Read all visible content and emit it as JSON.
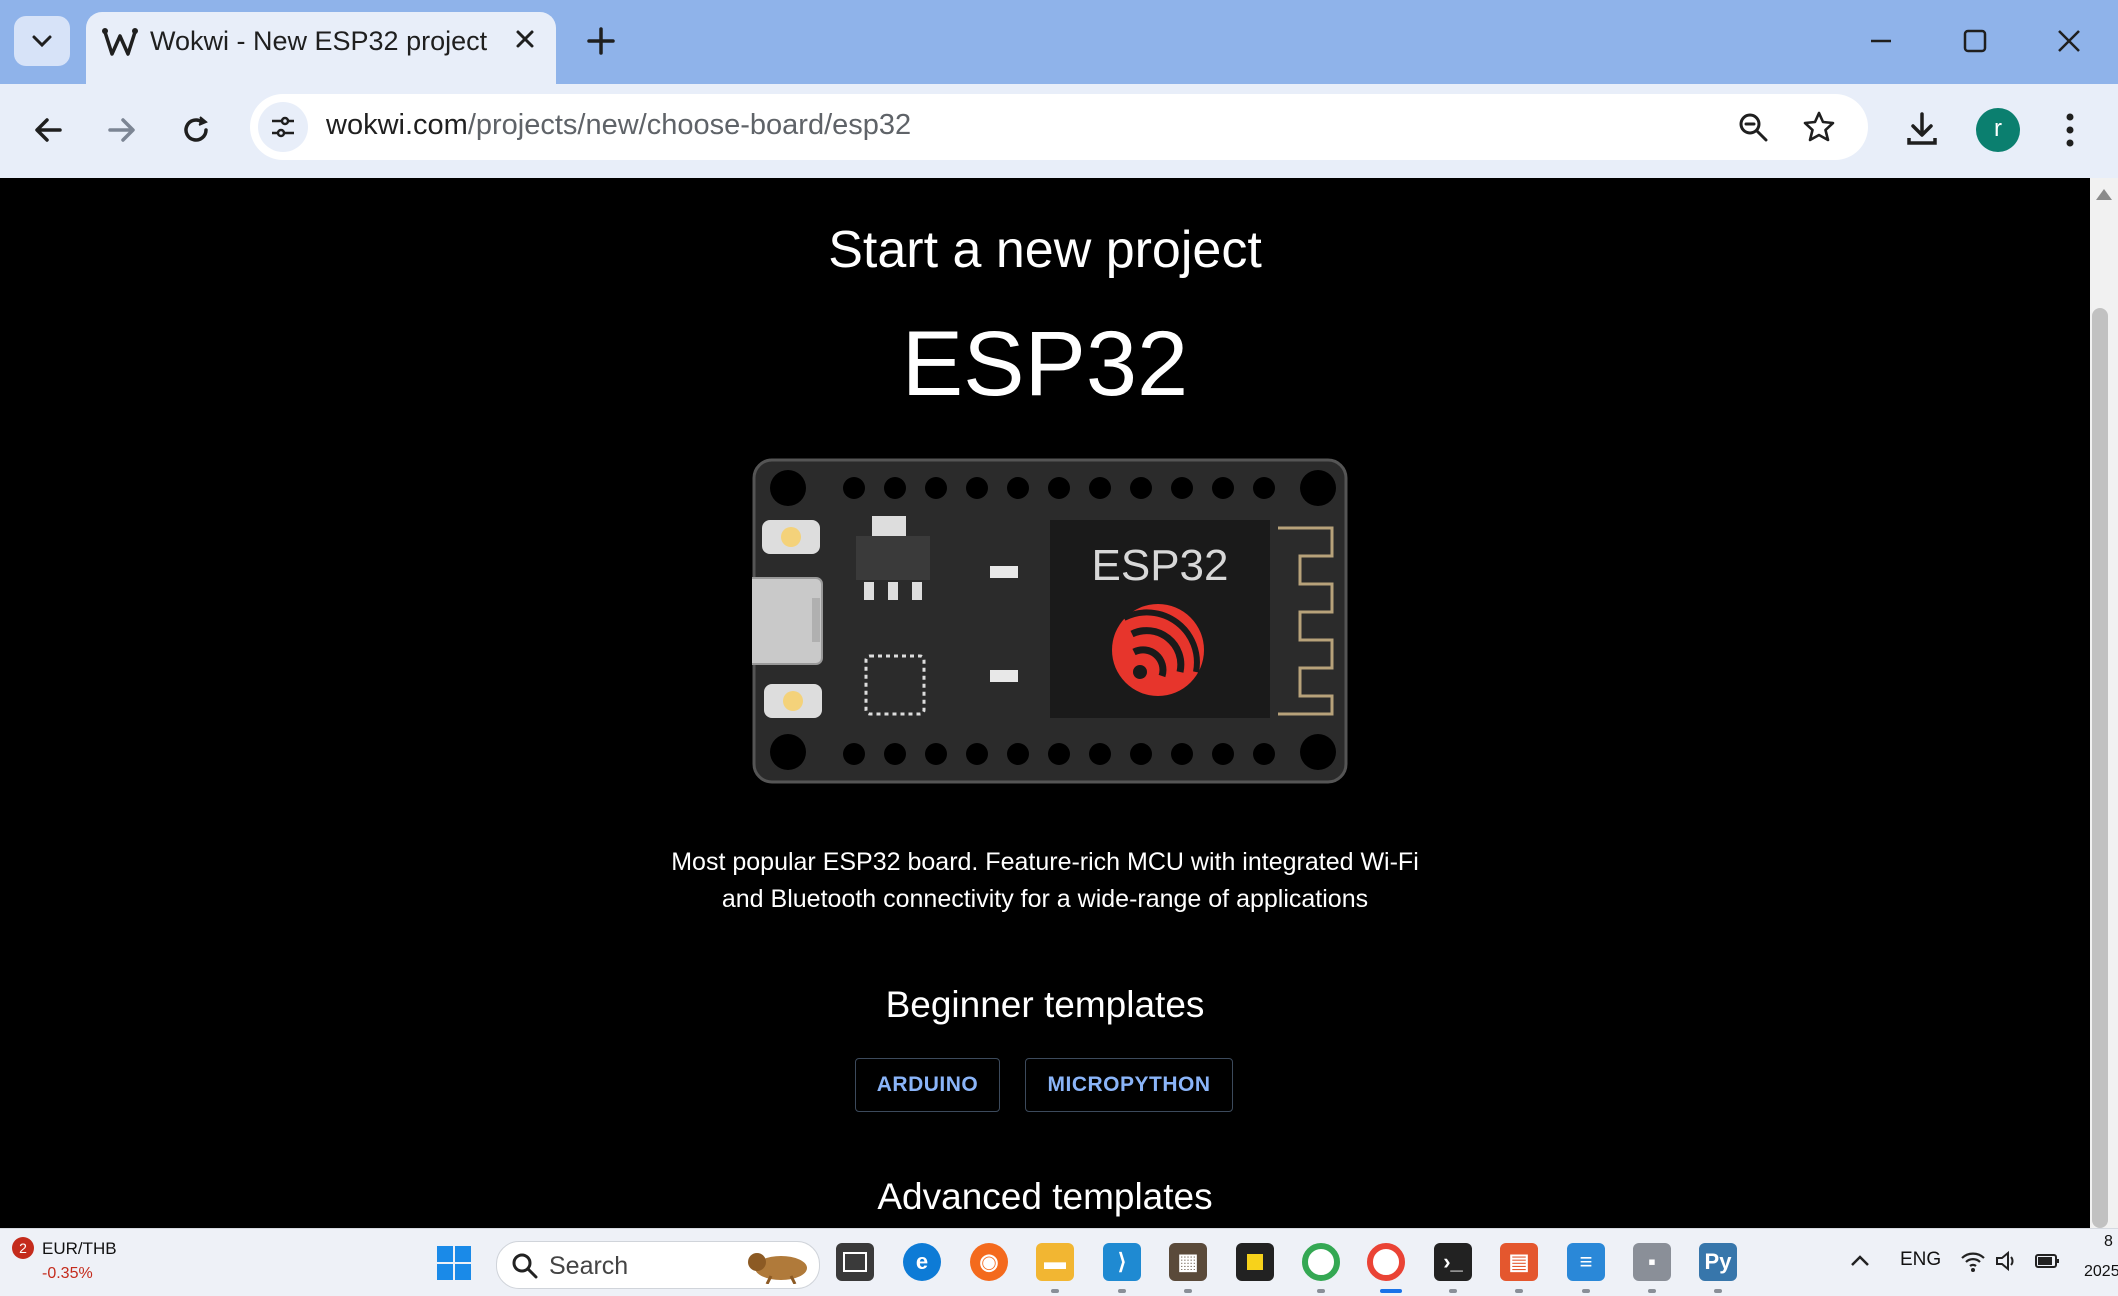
{
  "browser": {
    "tab_title": "Wokwi - New ESP32 project",
    "url_host": "wokwi.com",
    "url_path": "/projects/new/choose-board/esp32",
    "avatar_letter": "r"
  },
  "page": {
    "heading": "Start a new project",
    "board_name": "ESP32",
    "chip_label": "ESP32",
    "description_line1": "Most popular ESP32 board. Feature-rich MCU with integrated Wi-Fi",
    "description_line2": "and Bluetooth connectivity for a wide-range of applications",
    "beginner_heading": "Beginner templates",
    "beginner_templates": [
      "ARDUINO",
      "MICROPYTHON"
    ],
    "advanced_heading": "Advanced templates"
  },
  "taskbar": {
    "widget_badge": "2",
    "widget_title": "EUR/THB",
    "widget_value": "-0.35%",
    "search_placeholder": "Search",
    "language": "ENG",
    "clock_partial_top": "8",
    "clock_partial_bottom": "2025"
  },
  "colors": {
    "tabbar": "#8fb3ea",
    "toolbar": "#e8eef9",
    "page_bg": "#000000",
    "template_button_text": "#8ab4f8",
    "espressif_red": "#e7352c"
  }
}
